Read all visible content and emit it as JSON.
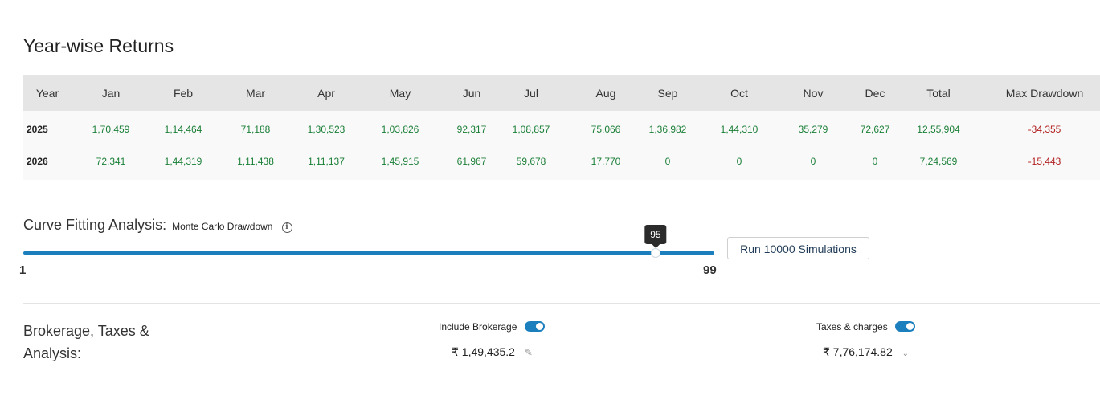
{
  "year_wise": {
    "title": "Year-wise Returns",
    "headers": [
      "Year",
      "Jan",
      "Feb",
      "Mar",
      "Apr",
      "May",
      "Jun",
      "Jul",
      "Aug",
      "Sep",
      "Oct",
      "Nov",
      "Dec",
      "Total",
      "Max Drawdown"
    ],
    "rows": [
      {
        "year": "2025",
        "values": [
          "1,70,459",
          "1,14,464",
          "71,188",
          "1,30,523",
          "1,03,826",
          "92,317",
          "1,08,857",
          "75,066",
          "1,36,982",
          "1,44,310",
          "35,279",
          "72,627",
          "12,55,904",
          "-34,355"
        ]
      },
      {
        "year": "2026",
        "values": [
          "72,341",
          "1,44,319",
          "1,11,438",
          "1,11,137",
          "1,45,915",
          "61,967",
          "59,678",
          "17,770",
          "0",
          "0",
          "0",
          "0",
          "7,24,569",
          "-15,443"
        ]
      }
    ]
  },
  "curve_fitting": {
    "title": "Curve Fitting Analysis:",
    "subtitle": "Monte Carlo Drawdown",
    "info_icon": "info-icon",
    "slider": {
      "min": "1",
      "max": "99",
      "value": "95"
    },
    "run_button_label": "Run 10000 Simulations"
  },
  "brokerage": {
    "title": "Brokerage, Taxes & Analysis:",
    "include_brokerage_label": "Include Brokerage",
    "include_brokerage_on": true,
    "brokerage_amount": "₹ 1,49,435.2",
    "taxes_label": "Taxes & charges",
    "taxes_on": true,
    "taxes_amount": "₹ 7,76,174.82"
  },
  "colors": {
    "accent": "#1b7fbd",
    "positive": "#1a7f37",
    "negative": "#b22222"
  }
}
